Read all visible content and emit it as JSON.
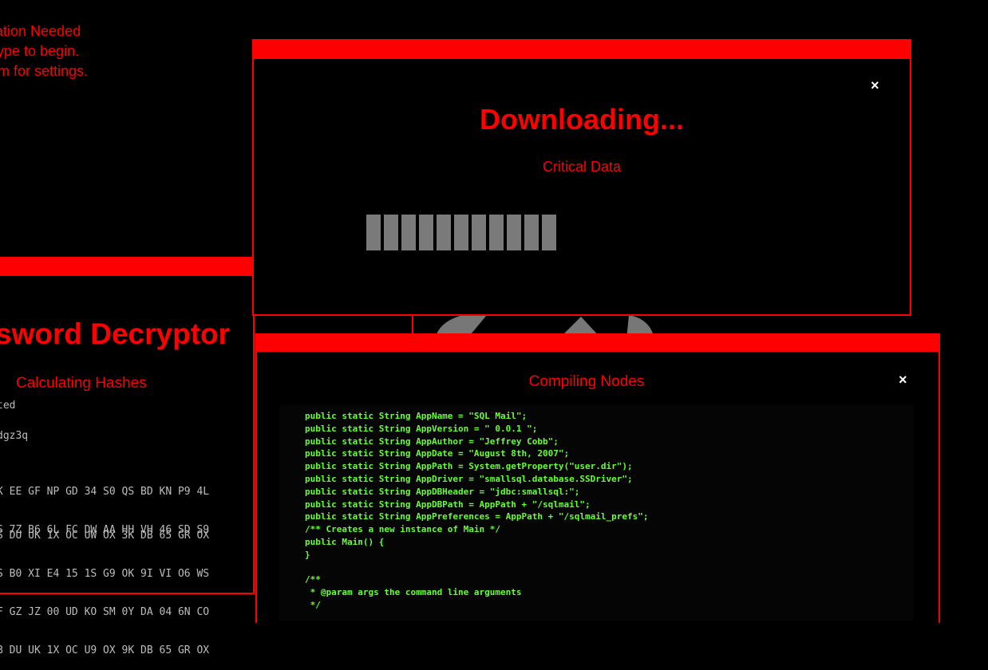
{
  "background_fragment": {
    "lines": [
      "ation Needed",
      "ype to begin.",
      "m for settings."
    ]
  },
  "password_window": {
    "title": "sword Decryptor",
    "subtitle": "Calculating Hashes",
    "line1": "ted",
    "line2": "dgz3q",
    "block1": [
      "K EE GF NP GD 34 S0 QS BD KN P9 4L",
      "S 7Z B6 6L FC DW AA HH VH 46 SD S9"
    ],
    "block2": [
      "S DU UK 1X OC UW OX 3K DB 65 GR OX",
      "S B0 XI E4 15 1S G9 OK 9I VI O6 WS",
      "F GZ JZ 00 UD KO SM 0Y DA 04 6N CO",
      "B DU UK 1X OC U9 OX 9K DB 65 GR OX"
    ]
  },
  "download_window": {
    "close_label": "×",
    "title": "Downloading...",
    "subtitle": "Critical Data",
    "progress_segments": 11
  },
  "compile_window": {
    "close_label": "×",
    "title": "Compiling Nodes",
    "code": [
      "public static String AppName = \"SQL Mail\";",
      "public static String AppVersion = \" 0.0.1 \";",
      "public static String AppAuthor = \"Jeffrey Cobb\";",
      "public static String AppDate = \"August 8th, 2007\";",
      "public static String AppPath = System.getProperty(\"user.dir\");",
      "public static String AppDriver = \"smallsql.database.SSDriver\";",
      "public static String AppDBHeader = \"jdbc:smallsql:\";",
      "public static String AppDBPath = AppPath + \"/sqlmail\";",
      "public static String AppPreferences = AppPath + \"/sqlmail_prefs\";",
      "/** Creates a new instance of Main */",
      "public Main() {",
      "}",
      "",
      "/**",
      " * @param args the command line arguments",
      " */"
    ]
  },
  "colors": {
    "accent": "#ff0000",
    "code": "#66ff33",
    "progress": "#7a7a7a",
    "close_icon": "#ffffff"
  }
}
